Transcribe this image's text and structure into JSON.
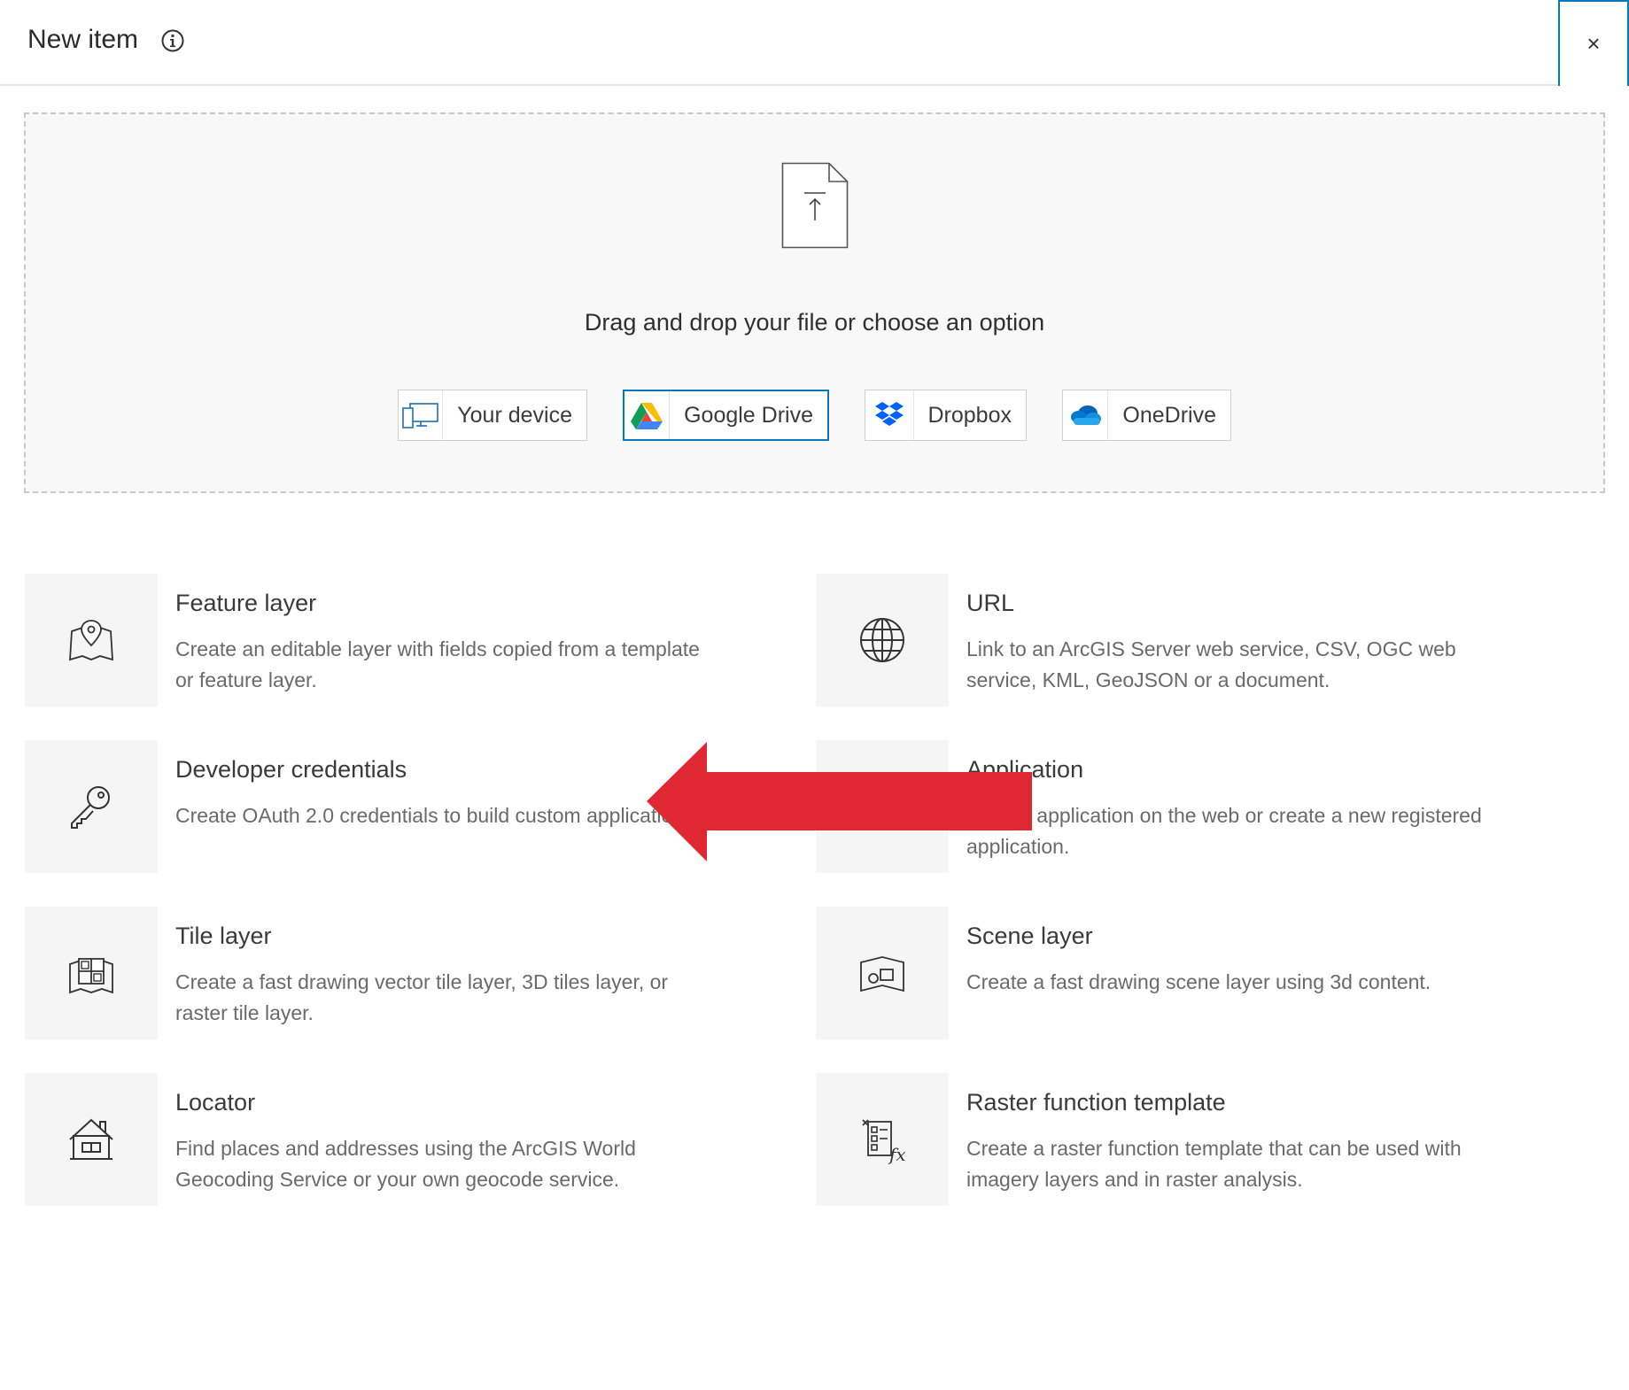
{
  "dialog": {
    "title": "New item",
    "close_label": "×"
  },
  "drop_zone": {
    "prompt": "Drag and drop your file or choose an option",
    "sources": [
      {
        "id": "your-device",
        "label": "Your device",
        "icon": "device-icon",
        "active": false
      },
      {
        "id": "google-drive",
        "label": "Google Drive",
        "icon": "google-drive-icon",
        "active": true
      },
      {
        "id": "dropbox",
        "label": "Dropbox",
        "icon": "dropbox-icon",
        "active": false
      },
      {
        "id": "onedrive",
        "label": "OneDrive",
        "icon": "onedrive-icon",
        "active": false
      }
    ]
  },
  "item_types": [
    {
      "title": "Feature layer",
      "description": "Create an editable layer with fields copied from a template or feature layer.",
      "icon": "map-pin-icon"
    },
    {
      "title": "URL",
      "description": "Link to an ArcGIS Server web service, CSV, OGC web service, KML, GeoJSON or a document.",
      "icon": "globe-icon"
    },
    {
      "title": "Developer credentials",
      "description": "Create OAuth 2.0 credentials to build custom applications.",
      "icon": "key-icon"
    },
    {
      "title": "Application",
      "description": "Add an application on the web or create a new registered application.",
      "icon": "application-icon"
    },
    {
      "title": "Tile layer",
      "description": "Create a fast drawing vector tile layer, 3D tiles layer, or raster tile layer.",
      "icon": "tile-layer-icon"
    },
    {
      "title": "Scene layer",
      "description": "Create a fast drawing scene layer using 3d content.",
      "icon": "scene-layer-icon"
    },
    {
      "title": "Locator",
      "description": "Find places and addresses using the ArcGIS World Geocoding Service or your own geocode service.",
      "icon": "house-icon"
    },
    {
      "title": "Raster function template",
      "description": "Create a raster function template that can be used with imagery layers and in raster analysis.",
      "icon": "raster-function-icon"
    }
  ],
  "annotation": {
    "icon": "red-arrow-icon",
    "color": "#e02832"
  },
  "colors": {
    "accent": "#0079c1"
  }
}
